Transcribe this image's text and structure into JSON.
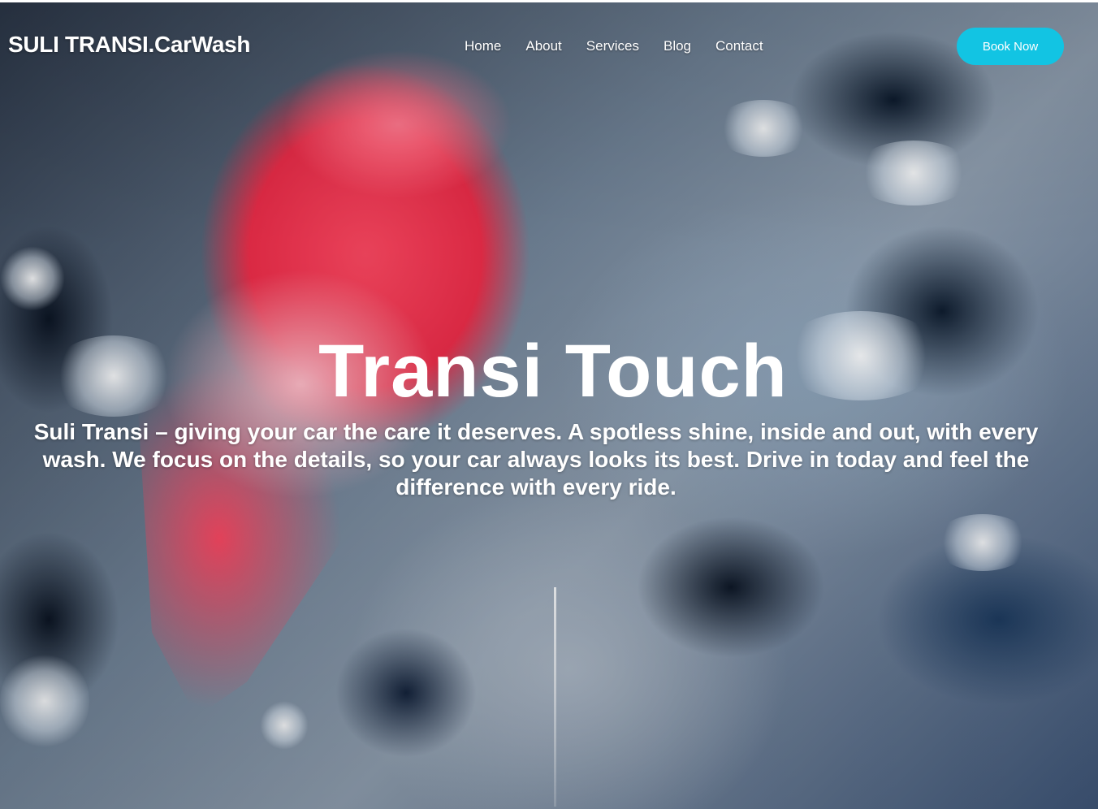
{
  "header": {
    "brand": "SULI TRANSI.CarWash",
    "nav": [
      "Home",
      "About",
      "Services",
      "Blog",
      "Contact"
    ],
    "cta_label": "Book Now"
  },
  "hero": {
    "title": "Transi Touch",
    "text": "Suli Transi – giving your car the care it deserves. A spotless shine, inside and out, with every wash. We focus on the details, so your car always looks its best. Drive in today and feel the difference with every ride."
  },
  "colors": {
    "accent": "#12c4e3",
    "text": "#ffffff"
  }
}
